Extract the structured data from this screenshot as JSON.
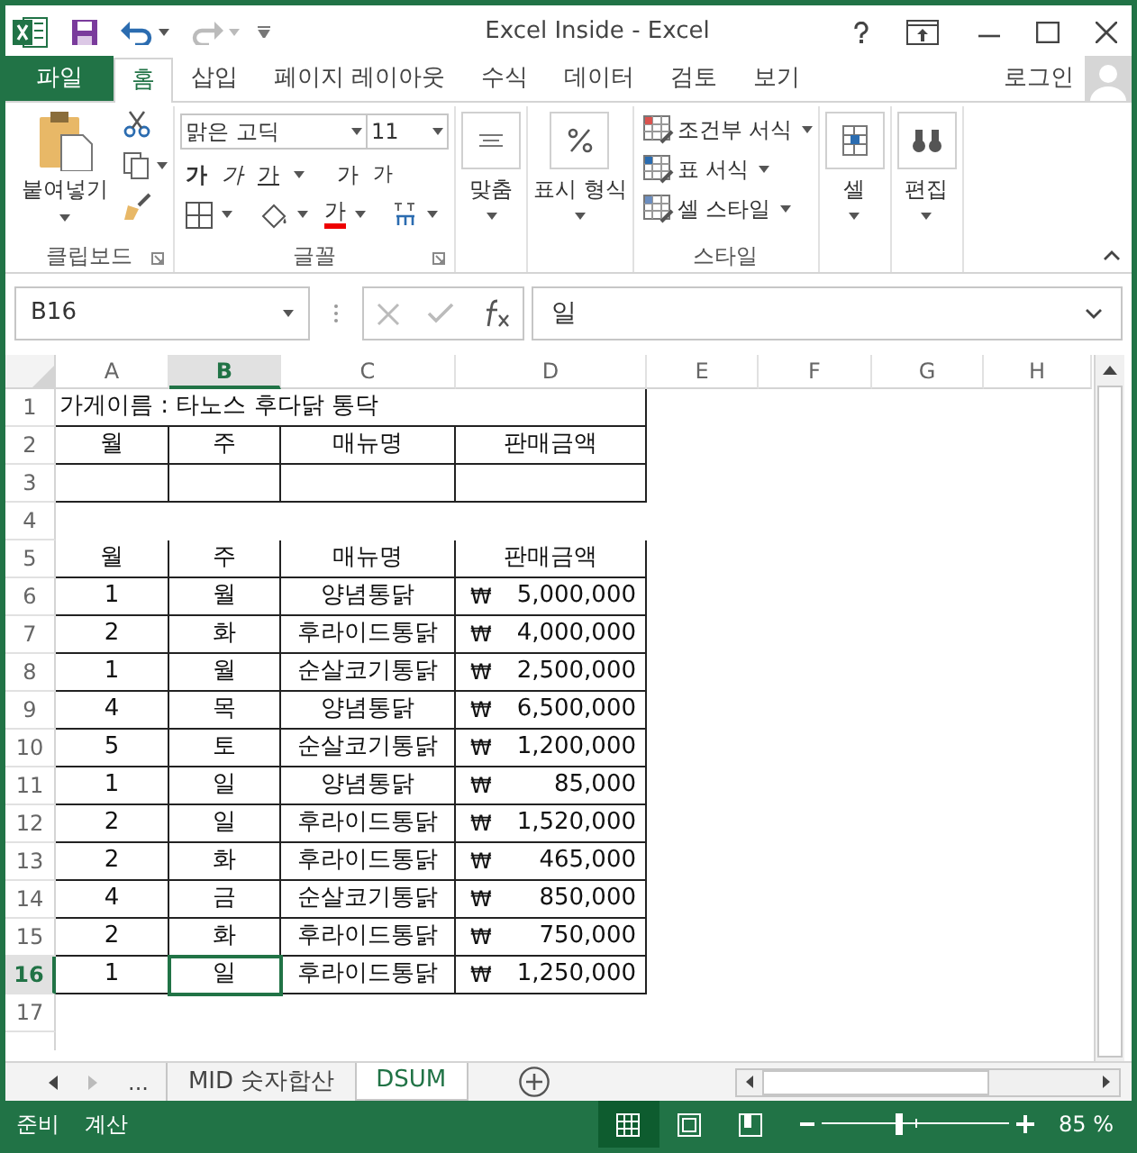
{
  "window": {
    "title": "Excel Inside - Excel"
  },
  "ribbon": {
    "tabs": [
      {
        "label": "파일",
        "kind": "file",
        "selected": false
      },
      {
        "label": "홈",
        "kind": "tab",
        "selected": true
      },
      {
        "label": "삽입",
        "kind": "tab",
        "selected": false
      },
      {
        "label": "페이지 레이아웃",
        "kind": "tab",
        "selected": false
      },
      {
        "label": "수식",
        "kind": "tab",
        "selected": false
      },
      {
        "label": "데이터",
        "kind": "tab",
        "selected": false
      },
      {
        "label": "검토",
        "kind": "tab",
        "selected": false
      },
      {
        "label": "보기",
        "kind": "tab",
        "selected": false
      }
    ],
    "account": "로그인",
    "clipboard": {
      "paste": "붙여넣기",
      "label": "클립보드"
    },
    "font": {
      "name": "맑은 고딕",
      "size": "11",
      "bold": "가",
      "italic": "가",
      "underline": "가",
      "grow": "가",
      "shrink": "가",
      "color_button": "가",
      "label": "글꼴"
    },
    "alignment": {
      "label": "맞춤"
    },
    "number": {
      "label": "표시 형식"
    },
    "styles": {
      "items": [
        "조건부 서식",
        "표 서식",
        "셀 스타일"
      ],
      "label": "스타일"
    },
    "cells": {
      "label": "셀"
    },
    "editing": {
      "label": "편집"
    }
  },
  "formula_bar": {
    "name_box": "B16",
    "value": "일"
  },
  "sheet": {
    "columns": [
      {
        "label": "A",
        "selected": false
      },
      {
        "label": "B",
        "selected": true
      },
      {
        "label": "C",
        "selected": false
      },
      {
        "label": "D",
        "selected": false
      },
      {
        "label": "E",
        "selected": false
      },
      {
        "label": "F",
        "selected": false
      },
      {
        "label": "G",
        "selected": false
      },
      {
        "label": "H",
        "selected": false
      }
    ],
    "rows": [
      {
        "number": "1",
        "selected": false,
        "kind": "title",
        "text": "가게이름 : 타노스 후다닭 통닥"
      },
      {
        "number": "2",
        "selected": false,
        "kind": "header",
        "cells": [
          "월",
          "주",
          "매뉴명",
          "판매금액"
        ]
      },
      {
        "number": "3",
        "selected": false,
        "kind": "boxed"
      },
      {
        "number": "4",
        "selected": false,
        "kind": "empty"
      },
      {
        "number": "5",
        "selected": false,
        "kind": "header",
        "cells": [
          "월",
          "주",
          "매뉴명",
          "판매금액"
        ]
      },
      {
        "number": "6",
        "selected": false,
        "kind": "data",
        "cells": [
          "1",
          "월",
          "양념통닭"
        ],
        "currency": "₩",
        "amount": "5,000,000"
      },
      {
        "number": "7",
        "selected": false,
        "kind": "data",
        "cells": [
          "2",
          "화",
          "후라이드통닭"
        ],
        "currency": "₩",
        "amount": "4,000,000"
      },
      {
        "number": "8",
        "selected": false,
        "kind": "data",
        "cells": [
          "1",
          "월",
          "순살코기통닭"
        ],
        "currency": "₩",
        "amount": "2,500,000"
      },
      {
        "number": "9",
        "selected": false,
        "kind": "data",
        "cells": [
          "4",
          "목",
          "양념통닭"
        ],
        "currency": "₩",
        "amount": "6,500,000"
      },
      {
        "number": "10",
        "selected": false,
        "kind": "data",
        "cells": [
          "5",
          "토",
          "순살코기통닭"
        ],
        "currency": "₩",
        "amount": "1,200,000"
      },
      {
        "number": "11",
        "selected": false,
        "kind": "data",
        "cells": [
          "1",
          "일",
          "양념통닭"
        ],
        "currency": "₩",
        "amount": "85,000"
      },
      {
        "number": "12",
        "selected": false,
        "kind": "data",
        "cells": [
          "2",
          "일",
          "후라이드통닭"
        ],
        "currency": "₩",
        "amount": "1,520,000"
      },
      {
        "number": "13",
        "selected": false,
        "kind": "data",
        "cells": [
          "2",
          "화",
          "후라이드통닭"
        ],
        "currency": "₩",
        "amount": "465,000"
      },
      {
        "number": "14",
        "selected": false,
        "kind": "data",
        "cells": [
          "4",
          "금",
          "순살코기통닭"
        ],
        "currency": "₩",
        "amount": "850,000"
      },
      {
        "number": "15",
        "selected": false,
        "kind": "data",
        "cells": [
          "2",
          "화",
          "후라이드통닭"
        ],
        "currency": "₩",
        "amount": "750,000"
      },
      {
        "number": "16",
        "selected": true,
        "kind": "data",
        "cells": [
          "1",
          "일",
          "후라이드통닭"
        ],
        "currency": "₩",
        "amount": "1,250,000"
      },
      {
        "number": "17",
        "selected": false,
        "kind": "empty"
      }
    ]
  },
  "sheet_tabs": {
    "more": "...",
    "tabs": [
      {
        "label": "MID 숫자합산",
        "selected": false
      },
      {
        "label": "DSUM",
        "selected": true
      }
    ]
  },
  "status_bar": {
    "mode": "준비",
    "calc": "계산",
    "views": [
      {
        "kind": "normal",
        "selected": true
      },
      {
        "kind": "layout",
        "selected": false
      },
      {
        "kind": "pagebreak",
        "selected": false
      }
    ],
    "zoom": {
      "level": 0.42
    },
    "zoom_text": "85 %"
  }
}
